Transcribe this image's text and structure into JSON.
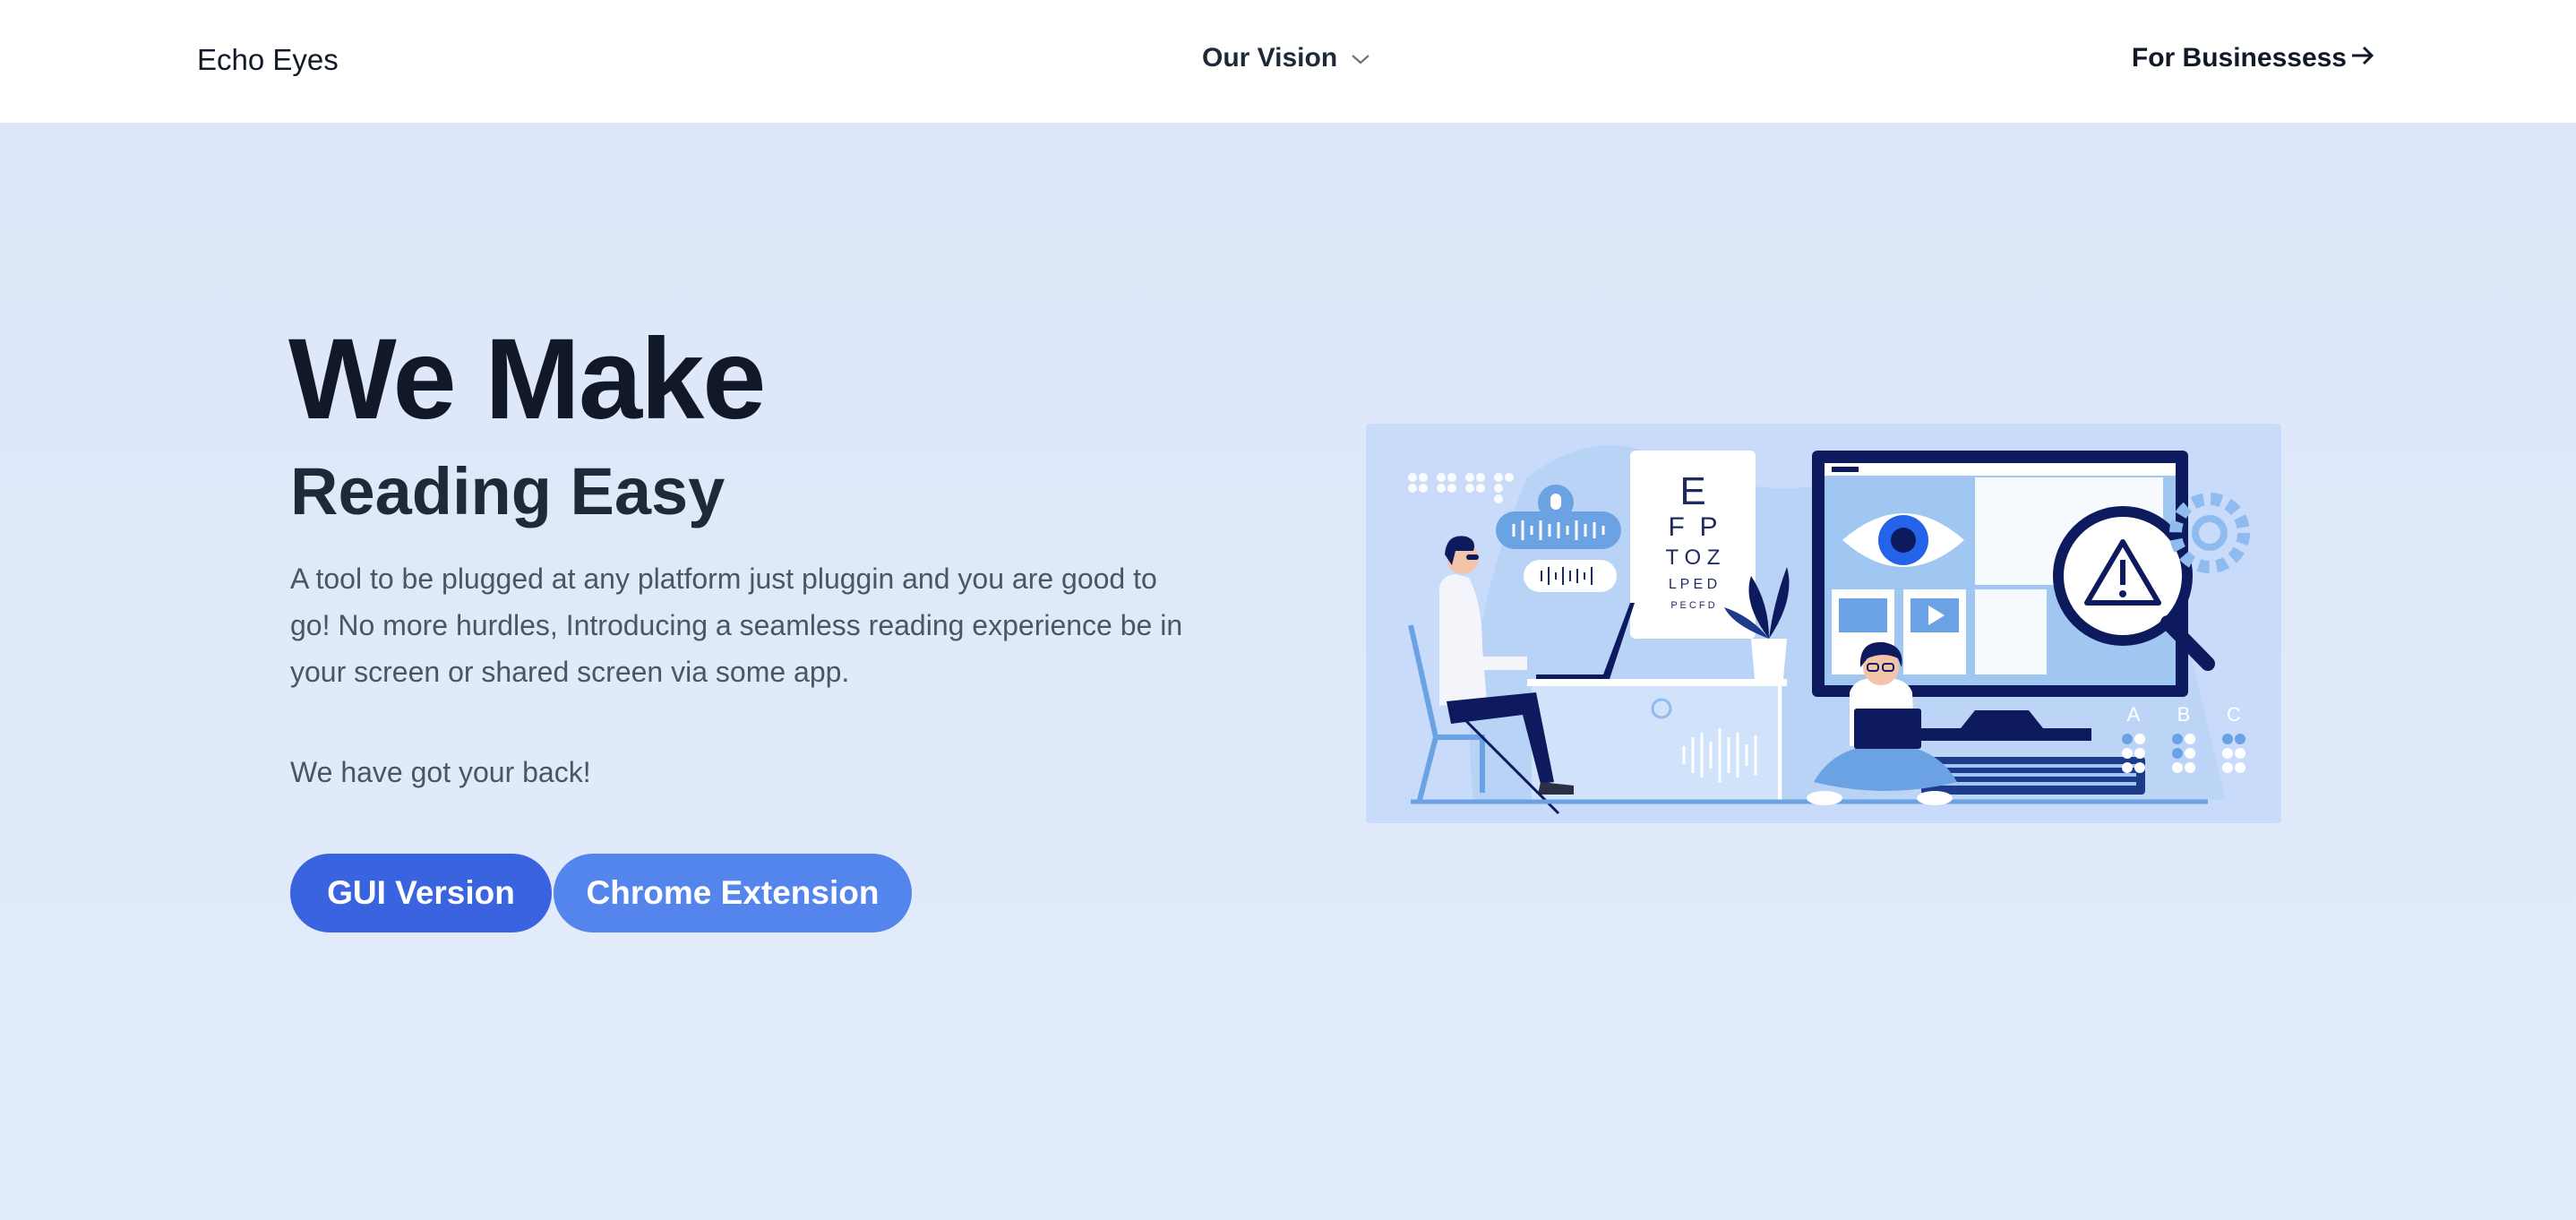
{
  "nav": {
    "brand": "Echo Eyes",
    "vision_label": "Our Vision",
    "business_label": "For Businessess"
  },
  "hero": {
    "title": "We Make",
    "subtitle": "Reading Easy",
    "description": "A tool to be plugged at any platform just pluggin and you are good to go! No more hurdles, Introducing a seamless reading experience be in your screen or shared screen via some app.",
    "tagline": "We have got your back!",
    "buttons": {
      "gui": "GUI Version",
      "chrome": "Chrome Extension"
    }
  },
  "illustration": {
    "eye_chart": [
      "E",
      "F  P",
      "T O Z",
      "L P E D",
      "P E C F D"
    ],
    "abc_labels": [
      "A",
      "B",
      "C"
    ]
  },
  "colors": {
    "primary_button": "#3a63e0",
    "secondary_button": "#5485ec",
    "hero_bg": "#dfe9f9",
    "navy": "#0d1b5e"
  }
}
